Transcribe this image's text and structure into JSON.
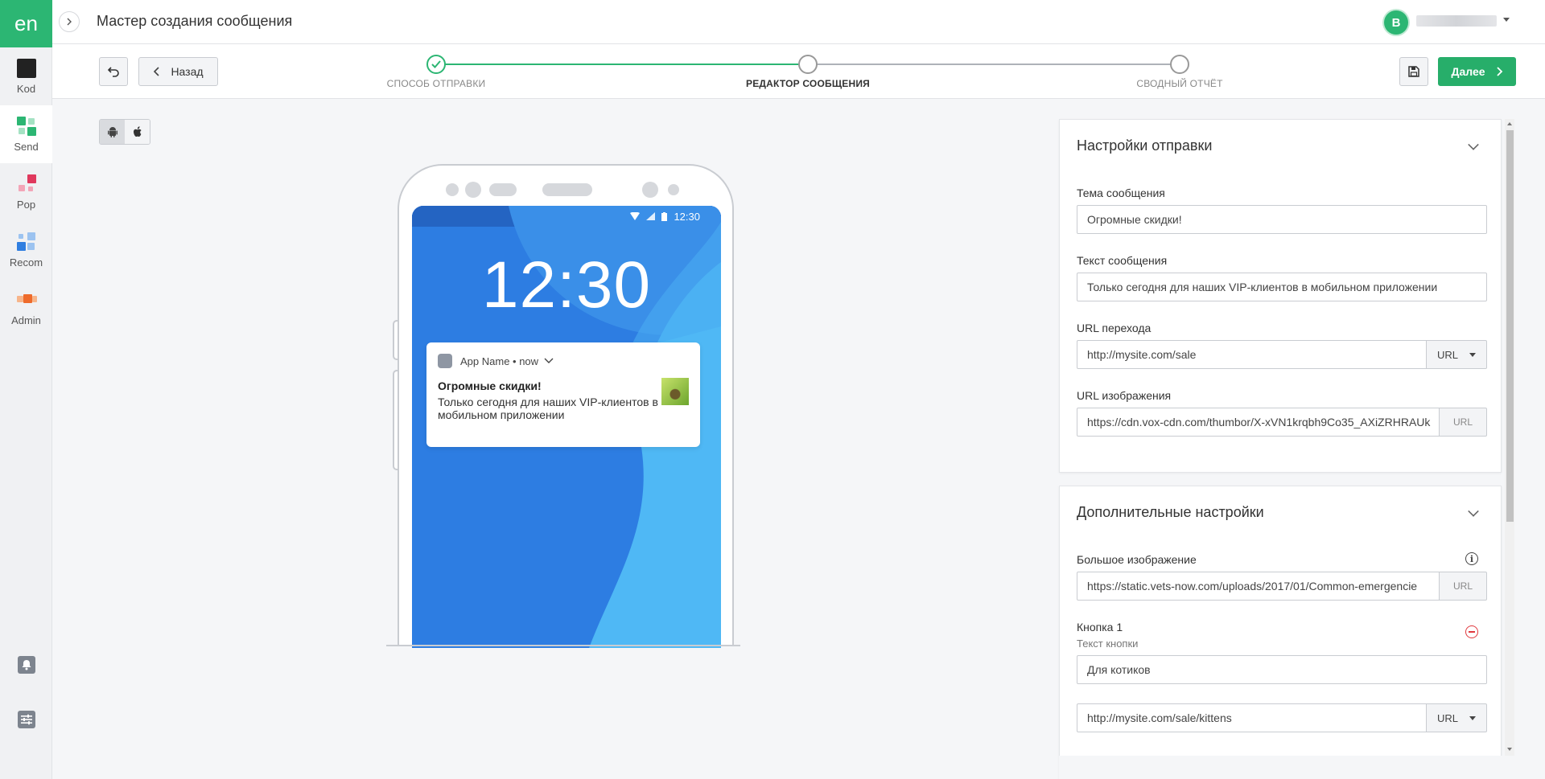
{
  "app": {
    "logo": "en",
    "page_title": "Мастер создания сообщения",
    "user_initial": "B"
  },
  "sidebar": {
    "items": [
      {
        "label": "Kod"
      },
      {
        "label": "Send"
      },
      {
        "label": "Pop"
      },
      {
        "label": "Recom"
      },
      {
        "label": "Admin"
      }
    ]
  },
  "toolbar": {
    "back_label": "Назад",
    "next_label": "Далее"
  },
  "stepper": {
    "steps": [
      {
        "label": "СПОСОБ ОТПРАВКИ",
        "state": "done"
      },
      {
        "label": "РЕДАКТОР СООБЩЕНИЯ",
        "state": "current"
      },
      {
        "label": "СВОДНЫЙ ОТЧЁТ",
        "state": "pending"
      }
    ]
  },
  "preview": {
    "status_time": "12:30",
    "clock": "12:30",
    "notification": {
      "app_line": "App Name • now",
      "title": "Огромные скидки!",
      "body": "Только сегодня для наших VIP-клиентов в мобильном приложении"
    }
  },
  "send_settings": {
    "title": "Настройки отправки",
    "subject_label": "Тема сообщения",
    "subject_value": "Огромные скидки!",
    "text_label": "Текст сообщения",
    "text_value": "Только сегодня для наших VIP-клиентов в мобильном приложении",
    "url_label": "URL перехода",
    "url_value": "http://mysite.com/sale",
    "url_type": "URL",
    "image_label": "URL изображения",
    "image_value": "https://cdn.vox-cdn.com/thumbor/X-xVN1krqbh9Co35_AXiZRHRAUk",
    "image_addon": "URL"
  },
  "extra_settings": {
    "title": "Дополнительные настройки",
    "big_image_label": "Большое изображение",
    "big_image_value": "https://static.vets-now.com/uploads/2017/01/Common-emergencie",
    "big_image_addon": "URL",
    "button1_label": "Кнопка 1",
    "button1_text_label": "Текст кнопки",
    "button1_text_value": "Для котиков",
    "button1_url_value": "http://mysite.com/sale/kittens",
    "button1_url_type": "URL"
  },
  "colors": {
    "brand": "#2cb673",
    "primary_button": "#27ae6a",
    "danger": "#e0393e",
    "screen_blue": "#2f7ee0"
  }
}
